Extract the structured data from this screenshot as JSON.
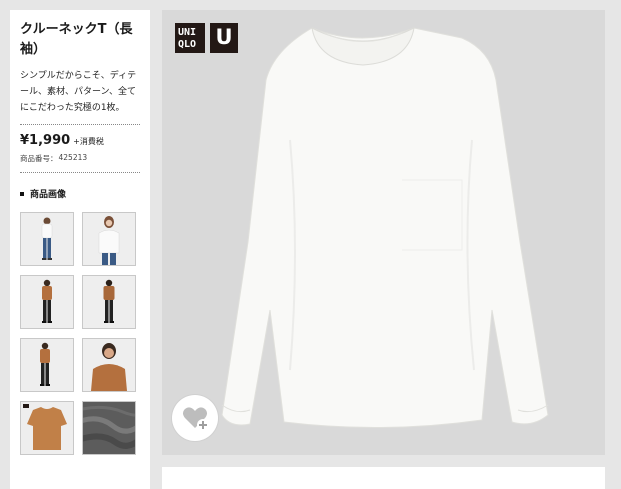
{
  "product": {
    "title": "クルーネックT（長袖）",
    "description": "シンプルだからこそ、ディテール、素材、パターン、全てにこだわった究極の1枚。",
    "price": "¥1,990",
    "tax_note": "+消費税",
    "product_number_label": "商品番号：",
    "product_number": "425213"
  },
  "images_section": {
    "heading": "商品画像"
  },
  "brand": {
    "logo_uniqlo_lines": [
      "UNI",
      "QLO"
    ],
    "logo_u_letter": "U",
    "logo_color": "#231815"
  },
  "thumbnails": [
    {
      "icon": "model-white-tee-full-body"
    },
    {
      "icon": "model-white-tee-front"
    },
    {
      "icon": "model-brown-tee-full-body"
    },
    {
      "icon": "model-brown-tee-back"
    },
    {
      "icon": "model-brown-tee-full-body-2"
    },
    {
      "icon": "model-brown-tee-closeup"
    },
    {
      "icon": "brown-tee-flat"
    },
    {
      "icon": "fabric-texture"
    }
  ],
  "main_image": {
    "icon": "white-long-sleeve-tee",
    "background": "#d9d9d9"
  },
  "favorite_icon": "heart-plus-icon"
}
